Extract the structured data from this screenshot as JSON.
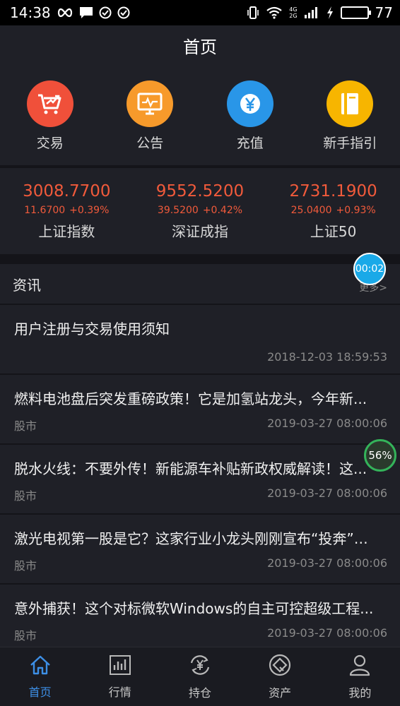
{
  "status_bar": {
    "time": "14:38",
    "battery": "77",
    "battery_level": 0.77,
    "net_4g": "4G",
    "net_2g": "2G"
  },
  "header": {
    "title": "首页"
  },
  "actions": [
    {
      "label": "交易",
      "icon": "trade-cart-icon",
      "color": "#f0503a"
    },
    {
      "label": "公告",
      "icon": "monitor-icon",
      "color": "#f79a2b"
    },
    {
      "label": "充值",
      "icon": "yen-coin-icon",
      "color": "#2996e8"
    },
    {
      "label": "新手指引",
      "icon": "book-icon",
      "color": "#f7b500"
    }
  ],
  "indices": [
    {
      "value": "3008.7700",
      "change": "11.6700",
      "percent": "+0.39%",
      "name": "上证指数"
    },
    {
      "value": "9552.5200",
      "change": "39.5200",
      "percent": "+0.42%",
      "name": "深证成指"
    },
    {
      "value": "2731.1900",
      "change": "25.0400",
      "percent": "+0.93%",
      "name": "上证50"
    }
  ],
  "news": {
    "title": "资讯",
    "more": "更多>",
    "items": [
      {
        "title": "用户注册与交易使用须知",
        "tag": "",
        "time": "2018-12-03 18:59:53"
      },
      {
        "title": "燃料电池盘后突发重磅政策！它是加氢站龙头，今年新...",
        "tag": "股市",
        "time": "2019-03-27 08:00:06"
      },
      {
        "title": "脱水火线：不要外传！新能源车补贴新政权威解读！这...",
        "tag": "股市",
        "time": "2019-03-27 08:00:06"
      },
      {
        "title": "激光电视第一股是它？这家行业小龙头刚刚宣布“投奔”科...",
        "tag": "股市",
        "time": "2019-03-27 08:00:06"
      },
      {
        "title": "意外捕获！这个对标微软Windows的自主可控超级工程...",
        "tag": "股市",
        "time": "2019-03-27 08:00:06"
      }
    ]
  },
  "floating": {
    "timer": "00:02",
    "percent": "56%"
  },
  "bottom_nav": [
    {
      "label": "首页",
      "icon": "home-icon",
      "active": true
    },
    {
      "label": "行情",
      "icon": "chart-icon",
      "active": false
    },
    {
      "label": "持仓",
      "icon": "yen-refresh-icon",
      "active": false
    },
    {
      "label": "资产",
      "icon": "asset-icon",
      "active": false
    },
    {
      "label": "我的",
      "icon": "user-icon",
      "active": false
    }
  ]
}
